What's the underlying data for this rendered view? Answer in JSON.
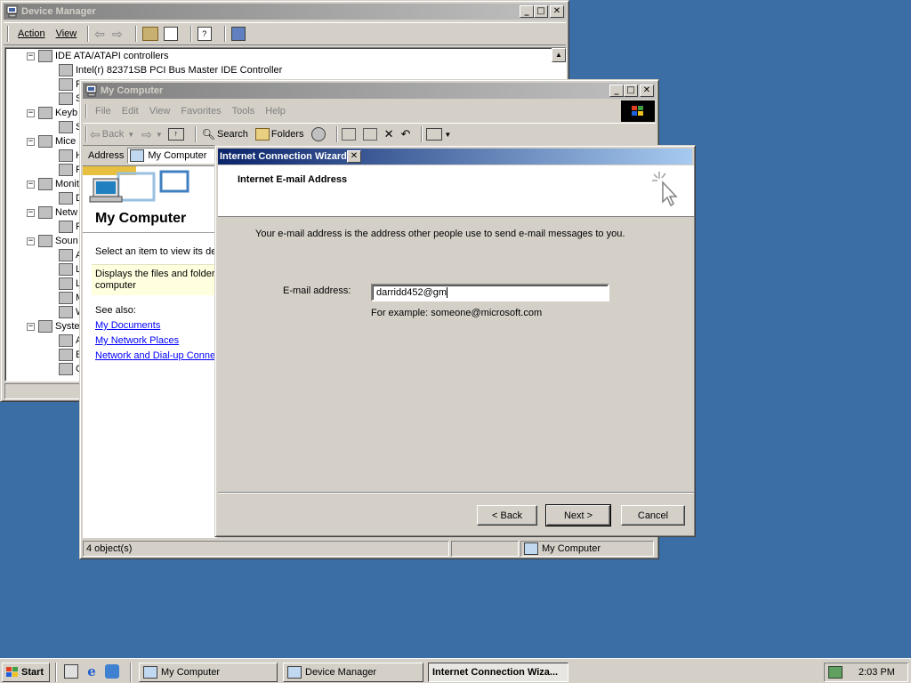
{
  "device_manager": {
    "title": "Device Manager",
    "menu": [
      "Action",
      "View"
    ],
    "tree": [
      {
        "label": "IDE ATA/ATAPI controllers",
        "expanded": true
      },
      {
        "label": "Intel(r) 82371SB PCI Bus Master IDE Controller",
        "child": true
      },
      {
        "label": "P",
        "child": true
      },
      {
        "label": "S",
        "child": true
      },
      {
        "label": "Keyb",
        "expanded": true
      },
      {
        "label": "S",
        "child": true
      },
      {
        "label": "Mice",
        "expanded": true
      },
      {
        "label": "H",
        "child": true
      },
      {
        "label": "P",
        "child": true
      },
      {
        "label": "Monit",
        "expanded": true
      },
      {
        "label": "D",
        "child": true
      },
      {
        "label": "Netw",
        "expanded": true
      },
      {
        "label": "R",
        "child": true
      },
      {
        "label": "Soun",
        "expanded": true
      },
      {
        "label": "A",
        "child": true
      },
      {
        "label": "L",
        "child": true
      },
      {
        "label": "L",
        "child": true
      },
      {
        "label": "M",
        "child": true
      },
      {
        "label": "W",
        "child": true
      },
      {
        "label": "Syste",
        "expanded": true
      },
      {
        "label": "A",
        "child": true
      },
      {
        "label": "E",
        "child": true
      },
      {
        "label": "G",
        "child": true
      }
    ]
  },
  "my_computer": {
    "title": "My Computer",
    "menu": [
      "File",
      "Edit",
      "View",
      "Favorites",
      "Tools",
      "Help"
    ],
    "toolbar": {
      "back": "Back",
      "search": "Search",
      "folders": "Folders"
    },
    "address_label": "Address",
    "address_value": "My Computer",
    "panel_title": "My Computer",
    "panel_text1": "Select an item to view its des",
    "panel_text2": "Displays the files and folders computer",
    "see_also": "See also:",
    "links": [
      "My Documents",
      "My Network Places",
      "Network and Dial-up Connec"
    ],
    "status_left": "4 object(s)",
    "status_right": "My Computer"
  },
  "wizard": {
    "title": "Internet Connection Wizard",
    "header": "Internet E-mail Address",
    "description": "Your e-mail address is the address other people use to send e-mail messages to you.",
    "email_label": "E-mail address:",
    "email_value": "darridd452@gm",
    "example": "For example: someone@microsoft.com",
    "back": "< Back",
    "next": "Next >",
    "cancel": "Cancel"
  },
  "taskbar": {
    "start": "Start",
    "tasks": [
      "My Computer",
      "Device Manager",
      "Internet Connection Wiza..."
    ],
    "clock": "2:03 PM"
  }
}
